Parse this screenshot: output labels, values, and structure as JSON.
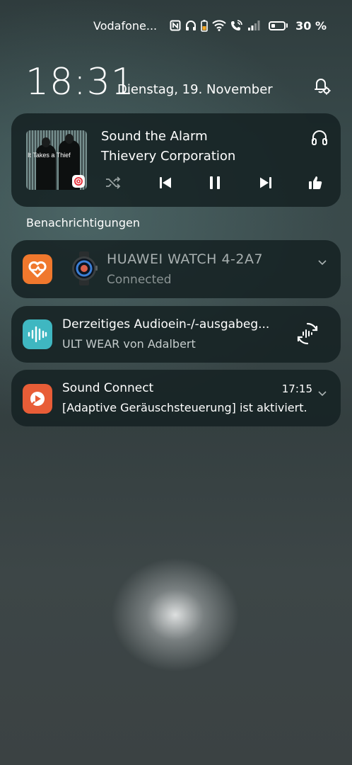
{
  "status_bar": {
    "carrier": "Vodafone...",
    "battery_percent": "30 %",
    "battery_level": 0.3,
    "icons": [
      "nfc-icon",
      "headphones-icon",
      "phone-battery-icon",
      "wifi-call-icon",
      "wifi-calling-icon",
      "signal-icon",
      "battery-icon"
    ]
  },
  "clock": {
    "time": "18:31",
    "date": "Dienstag, 19. November"
  },
  "media": {
    "title": "Sound the Alarm",
    "artist": "Thievery Corporation",
    "album_text": "It Takes a Thief",
    "controls": [
      "shuffle-icon",
      "previous-icon",
      "pause-icon",
      "next-icon",
      "thumbs-up-icon"
    ]
  },
  "notifications_header": "Benachrichtigungen",
  "notifications": {
    "watch": {
      "name": "HUAWEI WATCH 4-2A7",
      "status": "Connected"
    },
    "audio": {
      "title": "Derzeitiges Audioein-/-ausgabeg...",
      "subtitle": "ULT WEAR von Adalbert"
    },
    "sound_connect": {
      "app": "Sound Connect",
      "time": "17:15",
      "message": "[Adaptive Geräuschsteuerung] ist aktiviert."
    }
  },
  "colors": {
    "card_bg": "#162223",
    "health_icon": "#f0782d",
    "audio_icon": "#3fb7c1",
    "sound_connect_icon": "#e85d37"
  }
}
